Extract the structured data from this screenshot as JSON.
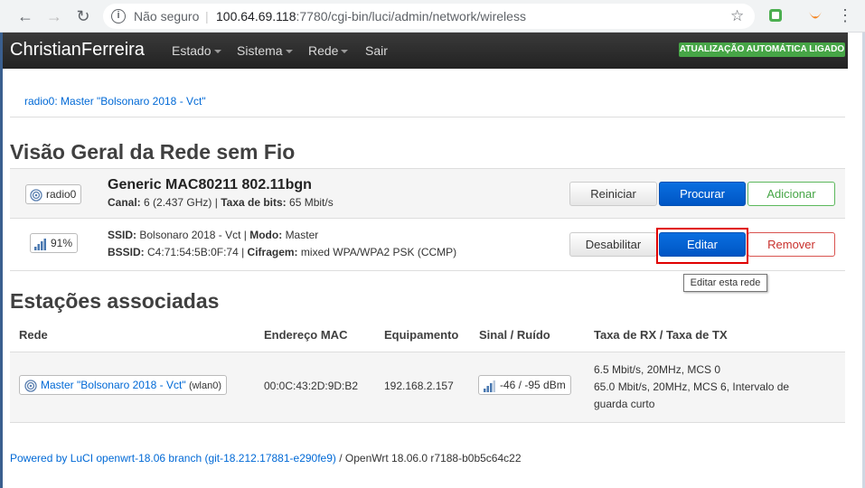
{
  "browser": {
    "security_label": "Não seguro",
    "url_host": "100.64.69.118",
    "url_path": ":7780/cgi-bin/luci/admin/network/wireless"
  },
  "navbar": {
    "brand": "ChristianFerreira",
    "items": [
      "Estado",
      "Sistema",
      "Rede",
      "Sair"
    ],
    "auto_refresh_badge": "ATUALIZAÇÃO AUTOMÁTICA LIGADO"
  },
  "tabs": {
    "radio_link": "radio0: Master \"Bolsonaro 2018 - Vct\""
  },
  "overview": {
    "title": "Visão Geral da Rede sem Fio",
    "device": {
      "badge": "radio0",
      "name": "Generic MAC80211 802.11bgn",
      "channel_label": "Canal:",
      "channel_value": "6 (2.437 GHz)",
      "bitrate_label": "Taxa de bits:",
      "bitrate_value": "65 Mbit/s",
      "buttons": {
        "restart": "Reiniciar",
        "scan": "Procurar",
        "add": "Adicionar"
      }
    },
    "network": {
      "signal_badge": "91%",
      "ssid_label": "SSID:",
      "ssid_value": "Bolsonaro 2018 - Vct",
      "mode_label": "Modo:",
      "mode_value": "Master",
      "bssid_label": "BSSID:",
      "bssid_value": "C4:71:54:5B:0F:74",
      "encryption_label": "Cifragem:",
      "encryption_value": "mixed WPA/WPA2 PSK (CCMP)",
      "buttons": {
        "disable": "Desabilitar",
        "edit": "Editar",
        "remove": "Remover"
      },
      "tooltip": "Editar esta rede"
    }
  },
  "stations": {
    "title": "Estações associadas",
    "headers": [
      "Rede",
      "Endereço MAC",
      "Equipamento",
      "Sinal / Ruído",
      "Taxa de RX / Taxa de TX"
    ],
    "row": {
      "network_link": "Master \"Bolsonaro 2018 - Vct\"",
      "iface": "(wlan0)",
      "mac": "00:0C:43:2D:9D:B2",
      "host": "192.168.2.157",
      "signal": "-46 / -95 dBm",
      "rate_line1": "6.5 Mbit/s, 20MHz, MCS 0",
      "rate_line2": "65.0 Mbit/s, 20MHz, MCS 6, Intervalo de",
      "rate_line3": "guarda curto"
    }
  },
  "footer": {
    "link": "Powered by LuCI openwrt-18.06 branch (git-18.212.17881-e290fe9)",
    "rest": " / OpenWrt 18.06.0 r7188-b0b5c64c22"
  },
  "colors": {
    "navbar": "#222222",
    "badge_green": "#46a546",
    "primary": "#0069d6",
    "highlight_box": "#e00000"
  }
}
